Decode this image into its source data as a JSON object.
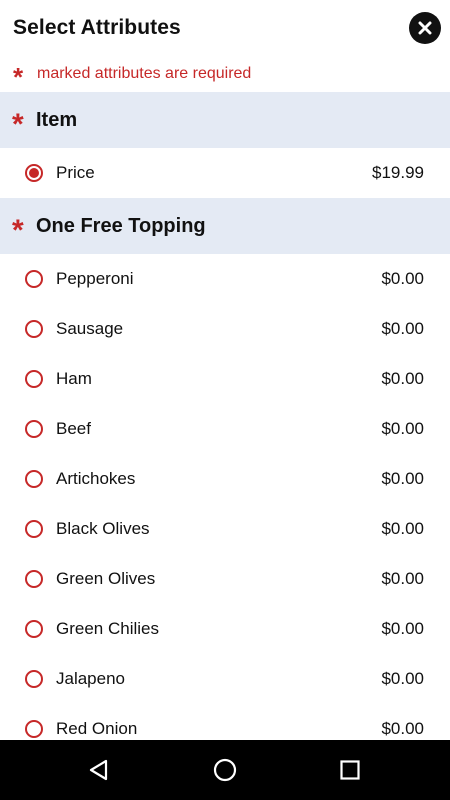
{
  "header": {
    "title": "Select Attributes",
    "close_icon": "close-icon"
  },
  "required_note": {
    "star": "*",
    "text": "marked attributes are required"
  },
  "sections": [
    {
      "star": "*",
      "title": "Item",
      "options": [
        {
          "label": "Price",
          "price": "$19.99",
          "selected": true
        }
      ]
    },
    {
      "star": "*",
      "title": "One Free Topping",
      "options": [
        {
          "label": "Pepperoni",
          "price": "$0.00",
          "selected": false
        },
        {
          "label": "Sausage",
          "price": "$0.00",
          "selected": false
        },
        {
          "label": "Ham",
          "price": "$0.00",
          "selected": false
        },
        {
          "label": "Beef",
          "price": "$0.00",
          "selected": false
        },
        {
          "label": "Artichokes",
          "price": "$0.00",
          "selected": false
        },
        {
          "label": "Black Olives",
          "price": "$0.00",
          "selected": false
        },
        {
          "label": "Green Olives",
          "price": "$0.00",
          "selected": false
        },
        {
          "label": "Green Chilies",
          "price": "$0.00",
          "selected": false
        },
        {
          "label": "Jalapeno",
          "price": "$0.00",
          "selected": false
        },
        {
          "label": "Red Onion",
          "price": "$0.00",
          "selected": false
        }
      ]
    }
  ],
  "navbar": {
    "back_icon": "back-triangle-icon",
    "home_icon": "home-circle-icon",
    "recents_icon": "recents-square-icon"
  },
  "colors": {
    "accent": "#c62828",
    "section_bg": "#e4eaf4",
    "navbar_bg": "#000000"
  }
}
